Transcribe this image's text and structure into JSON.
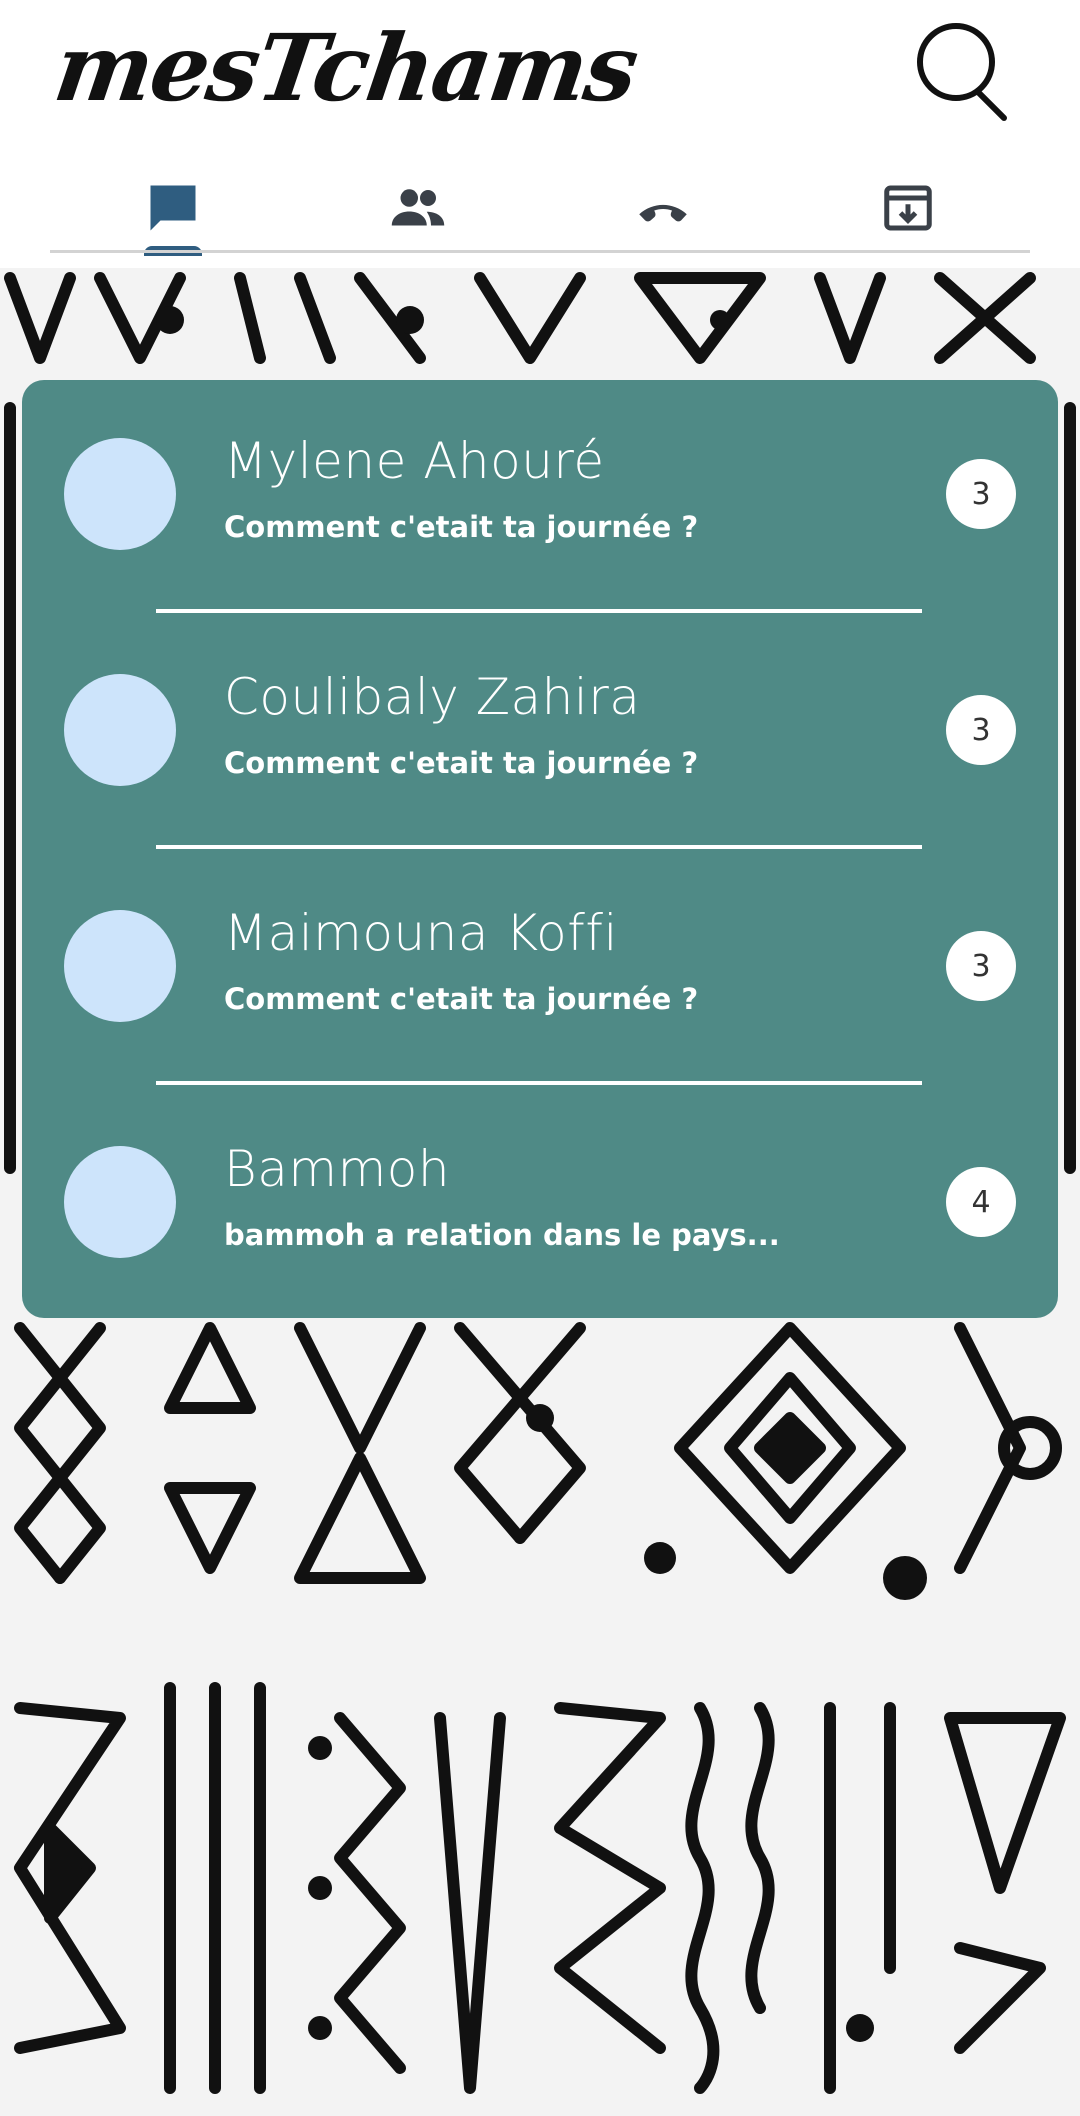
{
  "header": {
    "app_name": "mesTchams"
  },
  "tabs": [
    {
      "name": "chats",
      "icon": "chat-icon",
      "active": true
    },
    {
      "name": "contacts",
      "icon": "people-icon",
      "active": false
    },
    {
      "name": "calls",
      "icon": "phone-icon",
      "active": false
    },
    {
      "name": "archive",
      "icon": "archive-icon",
      "active": false
    }
  ],
  "colors": {
    "accent": "#2f5d80",
    "card": "#4f8a86",
    "avatar": "#cde4fb"
  },
  "chats": [
    {
      "name": "Mylene Ahouré",
      "last_message": "Comment c'etait ta journée  ?",
      "unread": "3"
    },
    {
      "name": "Coulibaly Zahira",
      "last_message": "Comment c'etait ta journée  ?",
      "unread": "3"
    },
    {
      "name": "Maimouna Koffi",
      "last_message": "Comment c'etait ta journée  ?",
      "unread": "3"
    },
    {
      "name": "Bammoh",
      "last_message": "bammoh a relation dans le pays...",
      "unread": "4"
    }
  ]
}
